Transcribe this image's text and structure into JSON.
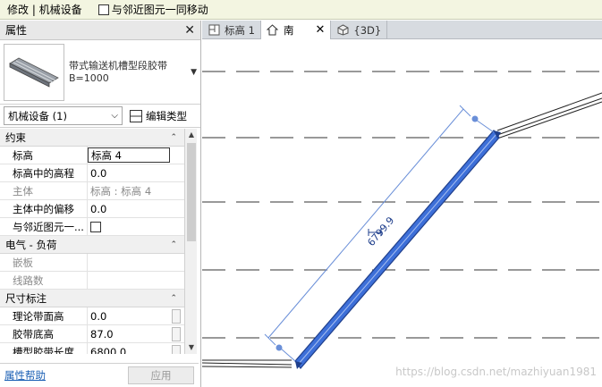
{
  "options_bar": {
    "context": "修改 | 机械设备",
    "checkbox_label": "与邻近图元一同移动"
  },
  "properties": {
    "title": "属性",
    "type_name_line1": "带式输送机槽型段胶带",
    "type_name_line2": "B=1000",
    "instance_selector": "机械设备 (1)",
    "edit_type": "编辑类型",
    "sections": [
      {
        "name": "约束",
        "rows": [
          {
            "key": "标高",
            "value": "标高 4"
          },
          {
            "key": "标高中的高程",
            "value": "0.0"
          },
          {
            "key": "主体",
            "value": "标高 : 标高 4"
          },
          {
            "key": "主体中的偏移",
            "value": "0.0"
          },
          {
            "key": "与邻近图元一...",
            "value": ""
          }
        ]
      },
      {
        "name": "电气 - 负荷",
        "rows": [
          {
            "key": "嵌板",
            "value": ""
          },
          {
            "key": "线路数",
            "value": ""
          }
        ]
      },
      {
        "name": "尺寸标注",
        "rows": [
          {
            "key": "理论带面高",
            "value": "0.0"
          },
          {
            "key": "胶带底高",
            "value": "87.0"
          },
          {
            "key": "槽型胶带长度",
            "value": "6800.0"
          }
        ]
      }
    ],
    "help_link": "属性帮助",
    "apply_button": "应用"
  },
  "tabs": [
    {
      "label": "标高 1",
      "icon": "floor-plan-icon"
    },
    {
      "label": "南",
      "icon": "elevation-icon"
    },
    {
      "label": "{3D}",
      "icon": "3d-view-icon"
    }
  ],
  "view": {
    "dimension_text": "6799.9",
    "watermark": "https://blog.csdn.net/mazhiyuan1981"
  },
  "colors": {
    "conveyor_fill": "#3d6fd8",
    "conveyor_stroke": "#1f3f8c",
    "dimension": "#6a8fd8"
  }
}
